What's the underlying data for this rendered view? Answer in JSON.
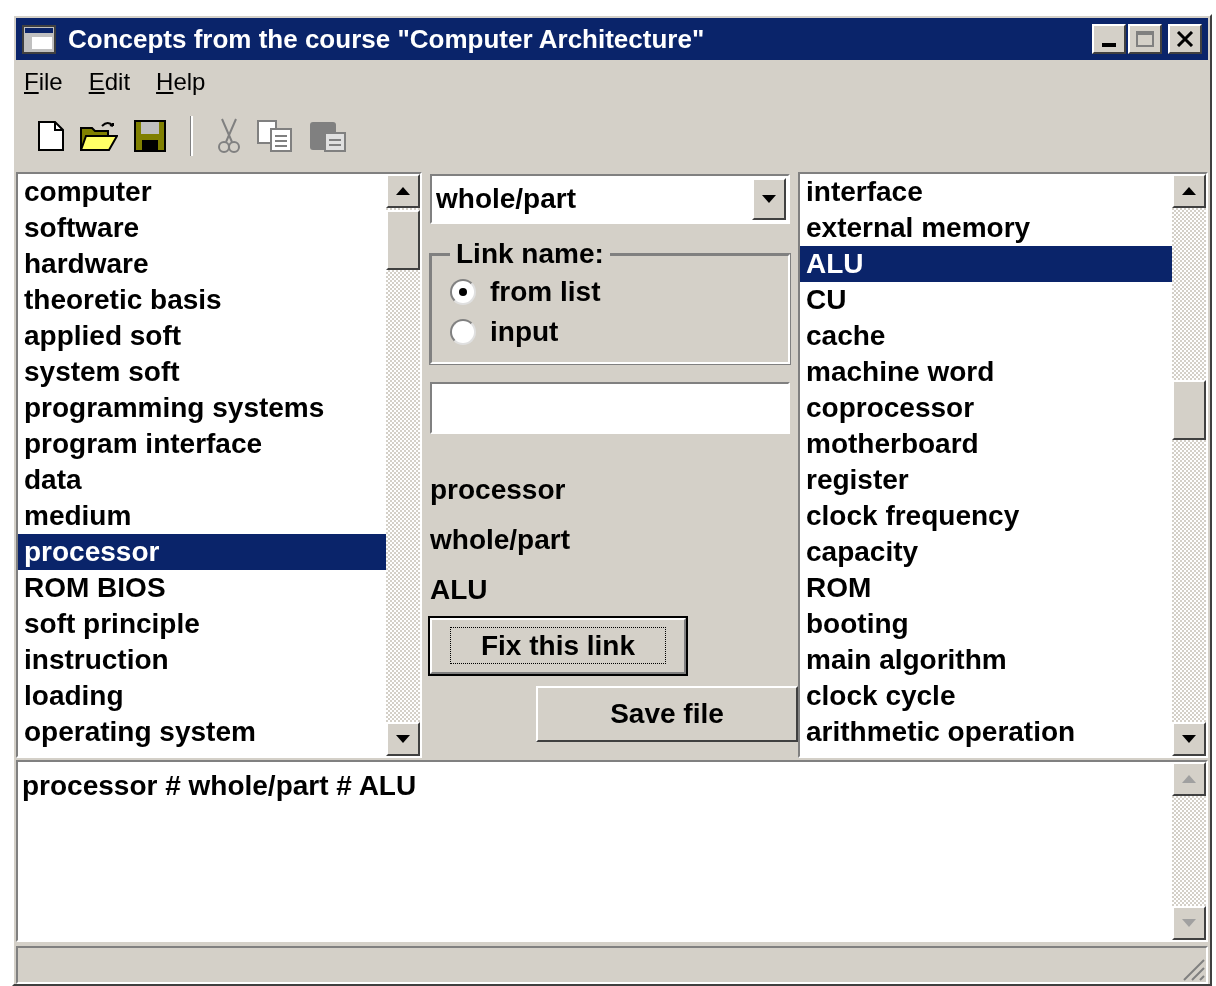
{
  "window": {
    "title": "Concepts from the course \"Computer Architecture\""
  },
  "menu": [
    {
      "label": "File"
    },
    {
      "label": "Edit"
    },
    {
      "label": "Help"
    }
  ],
  "toolbar": [
    {
      "kind": "new",
      "disabled": false
    },
    {
      "kind": "open",
      "disabled": false
    },
    {
      "kind": "save",
      "disabled": false
    },
    {
      "kind": "separator"
    },
    {
      "kind": "cut",
      "disabled": true
    },
    {
      "kind": "copy",
      "disabled": true
    },
    {
      "kind": "paste",
      "disabled": true
    }
  ],
  "left_list": [
    {
      "label": "computer",
      "selected": false
    },
    {
      "label": "software",
      "selected": false
    },
    {
      "label": "hardware",
      "selected": false
    },
    {
      "label": "theoretic basis",
      "selected": false
    },
    {
      "label": "applied soft",
      "selected": false
    },
    {
      "label": "system soft",
      "selected": false
    },
    {
      "label": "programming systems",
      "selected": false
    },
    {
      "label": "program interface",
      "selected": false
    },
    {
      "label": "data",
      "selected": false
    },
    {
      "label": "medium",
      "selected": false
    },
    {
      "label": "processor",
      "selected": true
    },
    {
      "label": "ROM BIOS",
      "selected": false
    },
    {
      "label": "soft principle",
      "selected": false
    },
    {
      "label": "instruction",
      "selected": false
    },
    {
      "label": "loading",
      "selected": false
    },
    {
      "label": "operating system",
      "selected": false
    }
  ],
  "link_combo": {
    "value": "whole/part"
  },
  "link_name_group": {
    "label": "Link name:",
    "options": [
      {
        "label": "from list",
        "selected": true
      },
      {
        "label": "input",
        "selected": false
      }
    ]
  },
  "summary": [
    "processor",
    "whole/part",
    "ALU"
  ],
  "buttons": [
    {
      "label": "Fix this link",
      "focused": true
    },
    {
      "label": "Save file",
      "focused": false
    }
  ],
  "right_list": [
    {
      "label": "interface",
      "selected": false
    },
    {
      "label": "external memory",
      "selected": false
    },
    {
      "label": "ALU",
      "selected": true
    },
    {
      "label": "CU",
      "selected": false
    },
    {
      "label": "cache",
      "selected": false
    },
    {
      "label": "machine word",
      "selected": false
    },
    {
      "label": "coprocessor",
      "selected": false
    },
    {
      "label": "motherboard",
      "selected": false
    },
    {
      "label": "register",
      "selected": false
    },
    {
      "label": "clock frequency",
      "selected": false
    },
    {
      "label": "capacity",
      "selected": false
    },
    {
      "label": "ROM",
      "selected": false
    },
    {
      "label": "booting",
      "selected": false
    },
    {
      "label": "main algorithm",
      "selected": false
    },
    {
      "label": "clock cycle",
      "selected": false
    },
    {
      "label": "arithmetic operation",
      "selected": false
    }
  ],
  "memo": {
    "lines": [
      "processor # whole/part # ALU"
    ]
  }
}
